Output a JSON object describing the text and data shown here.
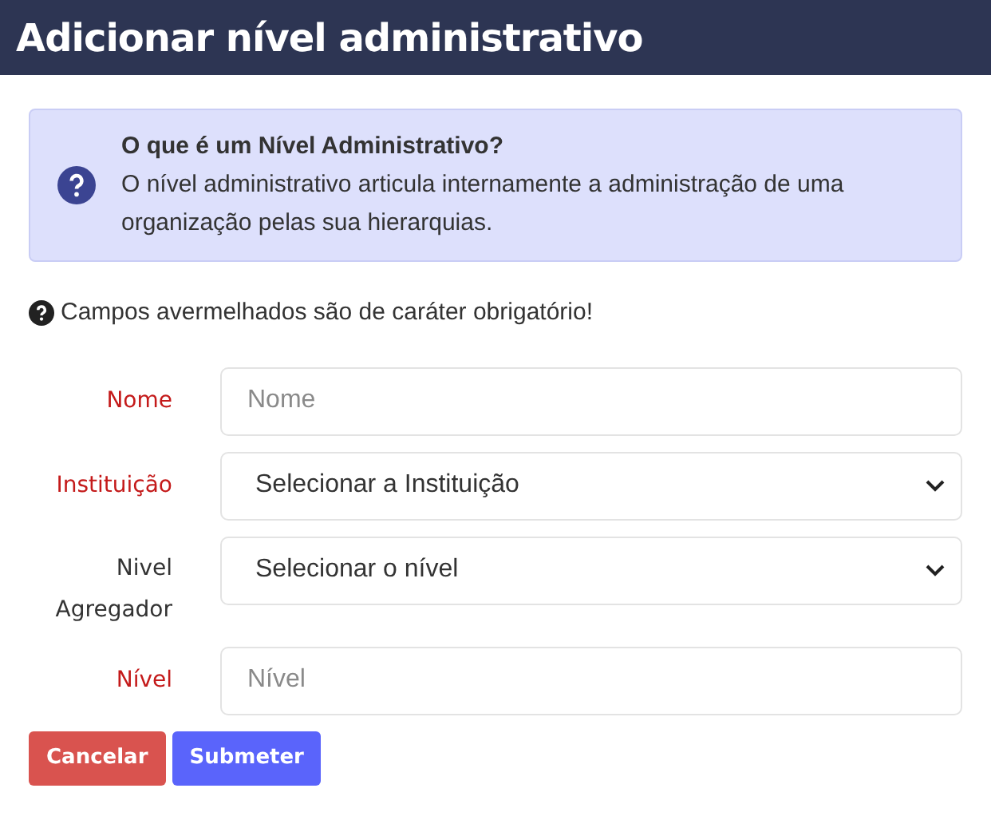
{
  "header": {
    "title": "Adicionar nível administrativo"
  },
  "info": {
    "title": "O que é um Nível Administrativo?",
    "text": "O nível administrativo articula internamente a administração de uma organização pelas sua hierarquias."
  },
  "note": "Campos avermelhados são de caráter obrigatório!",
  "fields": [
    {
      "label": "Nome",
      "kind": "input",
      "required": true,
      "placeholder": "Nome"
    },
    {
      "label": "Instituição",
      "kind": "select",
      "required": true,
      "value": "Selecionar a Instituição"
    },
    {
      "label": "Nivel Agregador",
      "kind": "select",
      "required": false,
      "value": "Selecionar o nível"
    },
    {
      "label": "Nível",
      "kind": "input",
      "required": true,
      "placeholder": "Nível"
    }
  ],
  "buttons": [
    {
      "label": "Cancelar",
      "kind": "cancel"
    },
    {
      "label": "Submeter",
      "kind": "submit"
    }
  ]
}
